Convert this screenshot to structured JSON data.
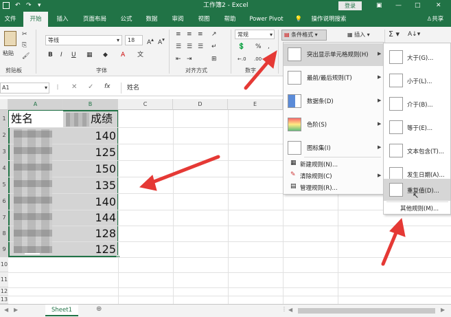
{
  "titlebar": {
    "doc_title": "工作簿2 - Excel",
    "login": "登录",
    "share": "共享"
  },
  "tabs": [
    "文件",
    "开始",
    "插入",
    "页面布局",
    "公式",
    "数据",
    "审阅",
    "视图",
    "帮助",
    "Power Pivot"
  ],
  "active_tab": "开始",
  "tell_me": "操作说明搜索",
  "ribbon": {
    "paste": "粘贴",
    "clipboard": "剪贴板",
    "font_name": "等线",
    "font_size": "18",
    "font_group": "字体",
    "align_group": "对齐方式",
    "number_format": "常规",
    "number_group": "数字",
    "conditional_format": "条件格式",
    "insert": "插入",
    "bold": "B",
    "italic": "I",
    "underline": "U",
    "percent": "%"
  },
  "formula_bar": {
    "name_box": "A1",
    "fx": "fx",
    "content": "姓名"
  },
  "columns": [
    "A",
    "B",
    "C",
    "D",
    "E"
  ],
  "rows": [
    "1",
    "2",
    "3",
    "4",
    "5",
    "6",
    "7",
    "8",
    "9",
    "10",
    "11",
    "12",
    "13"
  ],
  "header_cells": {
    "A1": "姓名",
    "B1": "成绩"
  },
  "scores": [
    "140",
    "125",
    "150",
    "135",
    "140",
    "144",
    "128",
    "125"
  ],
  "cf_menu": {
    "items": [
      {
        "label": "突出显示单元格规则(H)",
        "arrow": true
      },
      {
        "label": "最前/最后规则(T)",
        "arrow": true
      },
      {
        "label": "数据条(D)",
        "arrow": true
      },
      {
        "label": "色阶(S)",
        "arrow": true
      },
      {
        "label": "图标集(I)",
        "arrow": true
      }
    ],
    "text_items": [
      {
        "label": "新建规则(N)..."
      },
      {
        "label": "清除规则(C)",
        "arrow": true
      },
      {
        "label": "管理规则(R)..."
      }
    ]
  },
  "sub_menu": {
    "items": [
      {
        "label": "大于(G)..."
      },
      {
        "label": "小于(L)..."
      },
      {
        "label": "介于(B)..."
      },
      {
        "label": "等于(E)..."
      },
      {
        "label": "文本包含(T)..."
      },
      {
        "label": "发生日期(A)..."
      },
      {
        "label": "重复值(D)..."
      }
    ],
    "other": "其他规则(M)..."
  },
  "sheet_tab": "Sheet1",
  "colors": {
    "excel_green": "#217346",
    "red_arrow": "#e53935",
    "selection": "#d0d0d0"
  }
}
